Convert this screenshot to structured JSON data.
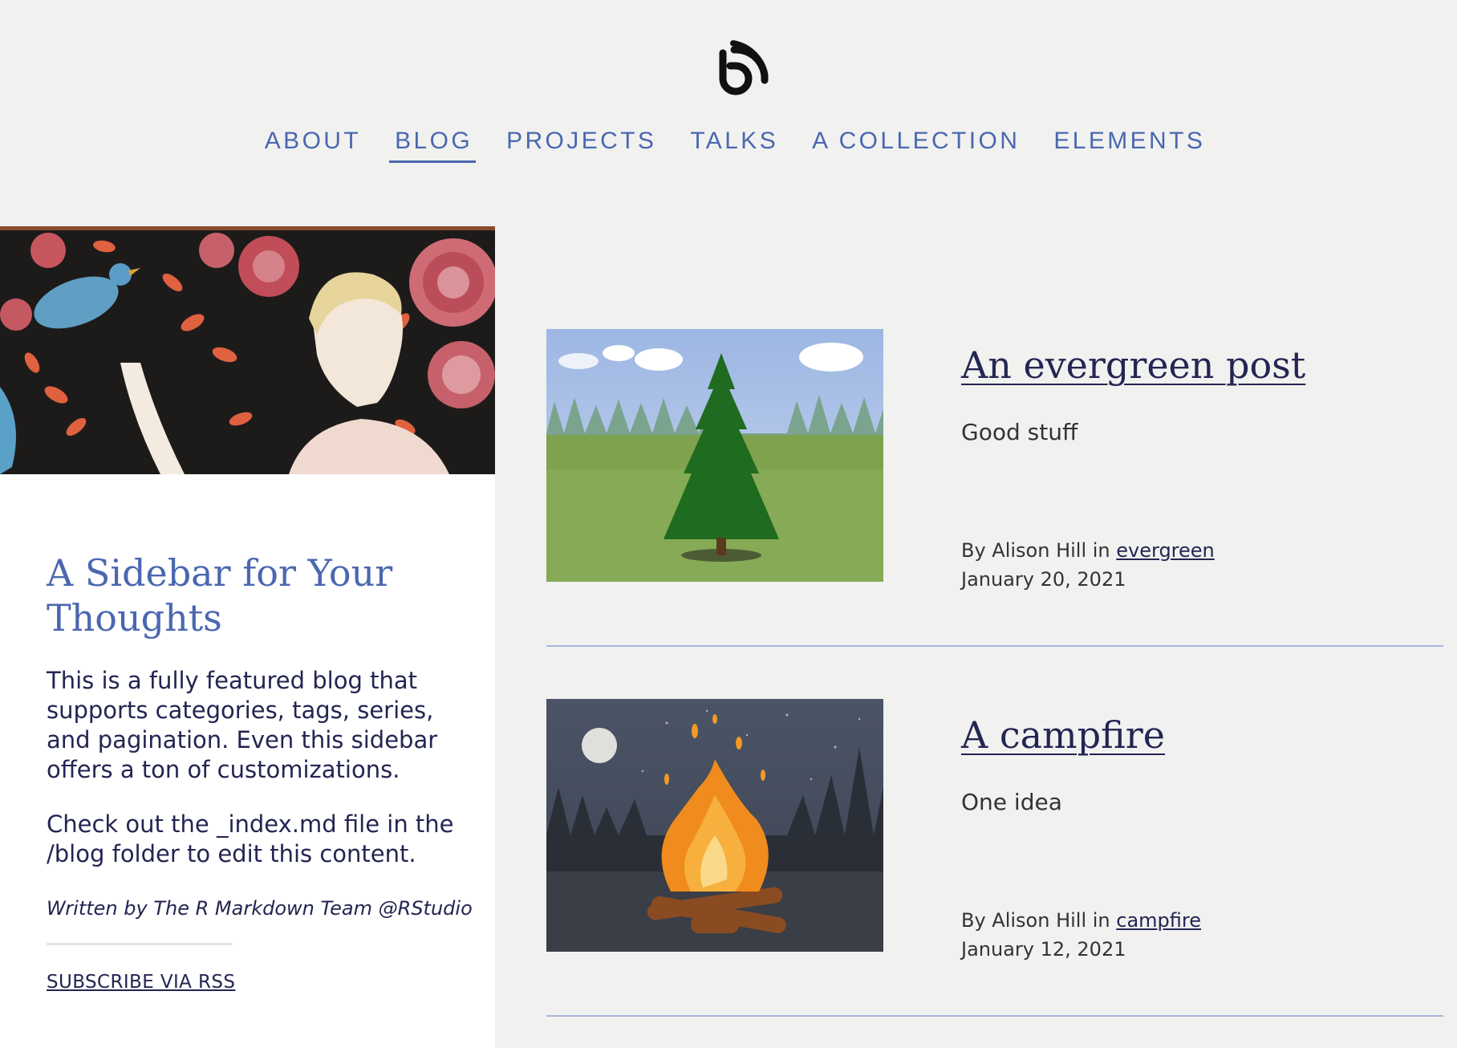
{
  "nav": {
    "items": [
      {
        "label": "ABOUT"
      },
      {
        "label": "BLOG"
      },
      {
        "label": "PROJECTS"
      },
      {
        "label": "TALKS"
      },
      {
        "label": "A COLLECTION"
      },
      {
        "label": "ELEMENTS"
      }
    ],
    "active": "BLOG"
  },
  "sidebar": {
    "title": "A Sidebar for Your Thoughts",
    "paragraph1": "This is a fully featured blog that supports categories, tags, series, and pagination. Even this sidebar offers a ton of customizations.",
    "paragraph2": "Check out the _index.md file in the /blog folder to edit this content.",
    "author": "Written by The R Markdown Team @RStudio",
    "rss_label": "SUBSCRIBE VIA RSS"
  },
  "posts": [
    {
      "title": "An evergreen post",
      "description": "Good stuff",
      "by": "By Alison Hill in ",
      "category": "evergreen",
      "date": "January 20, 2021"
    },
    {
      "title": "A campfire",
      "description": "One idea",
      "by": "By Alison Hill in ",
      "category": "campfire",
      "date": "January 12, 2021"
    }
  ],
  "colors": {
    "accent": "#4a67b0",
    "ink": "#232552",
    "background": "#f1f1f0"
  }
}
